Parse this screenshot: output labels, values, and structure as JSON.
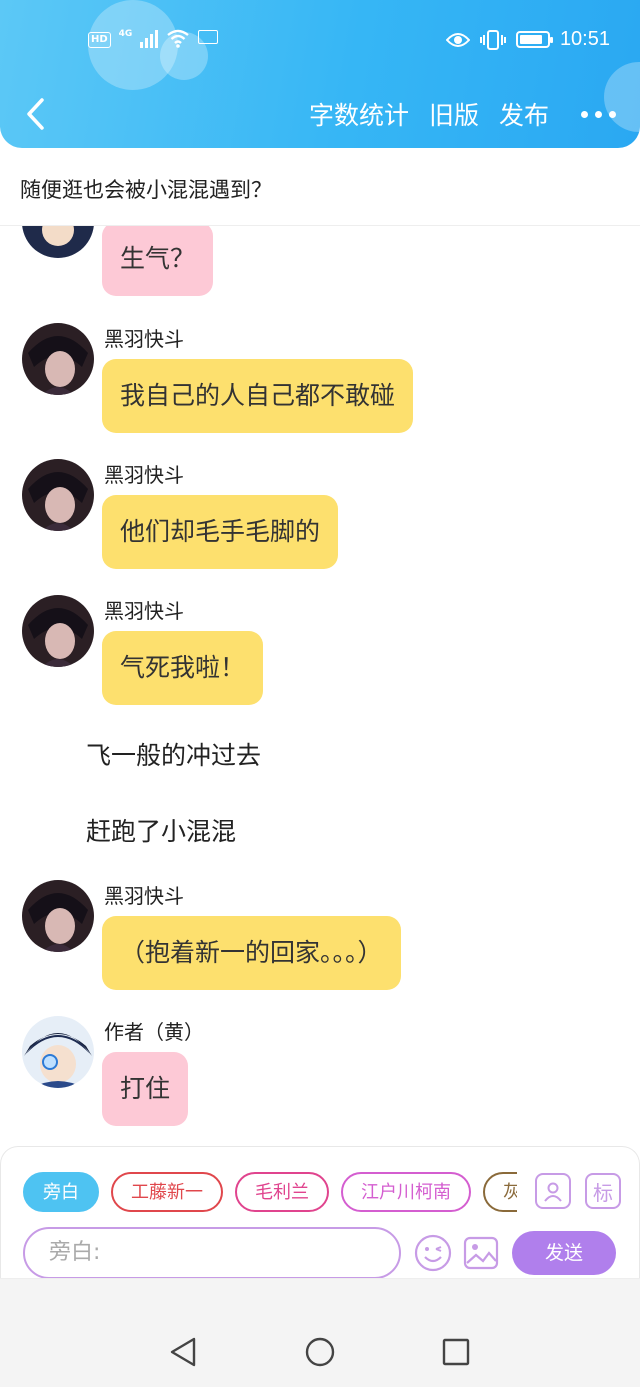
{
  "status_bar": {
    "time": "10:51",
    "hd_label": "HD",
    "network_label": "4G"
  },
  "toolbar": {
    "word_count": "字数统计",
    "old_version": "旧版",
    "publish": "发布"
  },
  "story_title": "随便逛也会被小混混遇到？",
  "messages": [
    {
      "type": "bubble",
      "color": "pink",
      "text": "生气？",
      "avatar": "author-avatar"
    },
    {
      "type": "bubble",
      "color": "yellow",
      "name": "黑羽快斗",
      "text": "我自己的人自己都不敢碰",
      "avatar": "kaito-avatar"
    },
    {
      "type": "bubble",
      "color": "yellow",
      "name": "黑羽快斗",
      "text": "他们却毛手毛脚的",
      "avatar": "kaito-avatar"
    },
    {
      "type": "bubble",
      "color": "yellow",
      "name": "黑羽快斗",
      "text": "气死我啦！",
      "avatar": "kaito-avatar"
    },
    {
      "type": "narration",
      "text": "飞一般的冲过去"
    },
    {
      "type": "narration",
      "text": "赶跑了小混混"
    },
    {
      "type": "bubble",
      "color": "yellow",
      "name": "黑羽快斗",
      "text": "（抱着新一的回家。。。）",
      "avatar": "kaito-avatar"
    },
    {
      "type": "bubble",
      "color": "pink",
      "name": "作者（黄）",
      "text": "打住",
      "avatar": "author-avatar"
    }
  ],
  "role_chips": [
    {
      "label": "旁白",
      "active": true,
      "color": "#4ec3f2"
    },
    {
      "label": "工藤新一",
      "active": false,
      "color": "#e0474c"
    },
    {
      "label": "毛利兰",
      "active": false,
      "color": "#e0448e"
    },
    {
      "label": "江户川柯南",
      "active": false,
      "color": "#d45ed0"
    },
    {
      "label": "灰",
      "active": false,
      "color": "#8a6a3a"
    }
  ],
  "input": {
    "placeholder": "旁白:",
    "send_label": "发送",
    "mark_label": "标"
  },
  "colors": {
    "header_gradient_start": "#5cc8f6",
    "header_gradient_end": "#2aa8f2",
    "yellow_bubble": "#fde06e",
    "pink_bubble": "#fdc9d6",
    "accent_purple": "#b07fec"
  }
}
